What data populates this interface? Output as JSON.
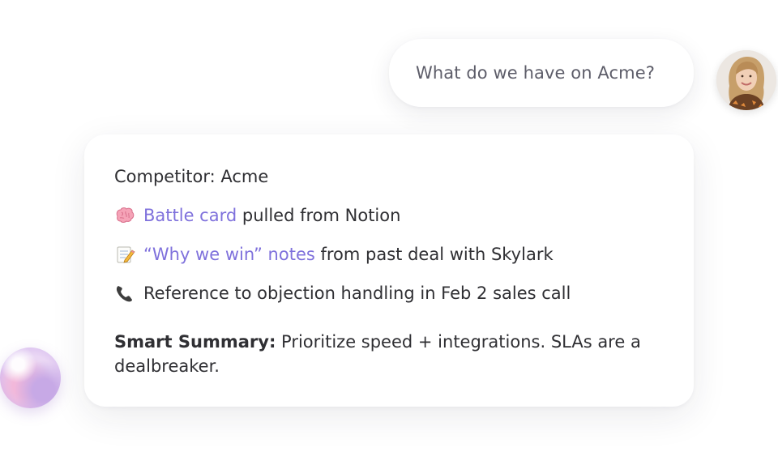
{
  "user_message": {
    "text": "What do we have on Acme?"
  },
  "reply": {
    "title": "Competitor: Acme",
    "items": [
      {
        "icon": "brain-icon",
        "link": "Battle card",
        "rest": " pulled from Notion"
      },
      {
        "icon": "memo-icon",
        "link": "“Why we win” notes",
        "rest": " from past deal with Skylark"
      },
      {
        "icon": "phone-icon",
        "link": "",
        "rest": "Reference to objection handling in Feb 2 sales call"
      }
    ],
    "summary_label": "Smart Summary:",
    "summary_text": " Prioritize speed + integrations. SLAs are a dealbreaker."
  },
  "colors": {
    "link": "#7f71dc",
    "text": "#2f2f33",
    "user_text": "#5d5d69"
  }
}
